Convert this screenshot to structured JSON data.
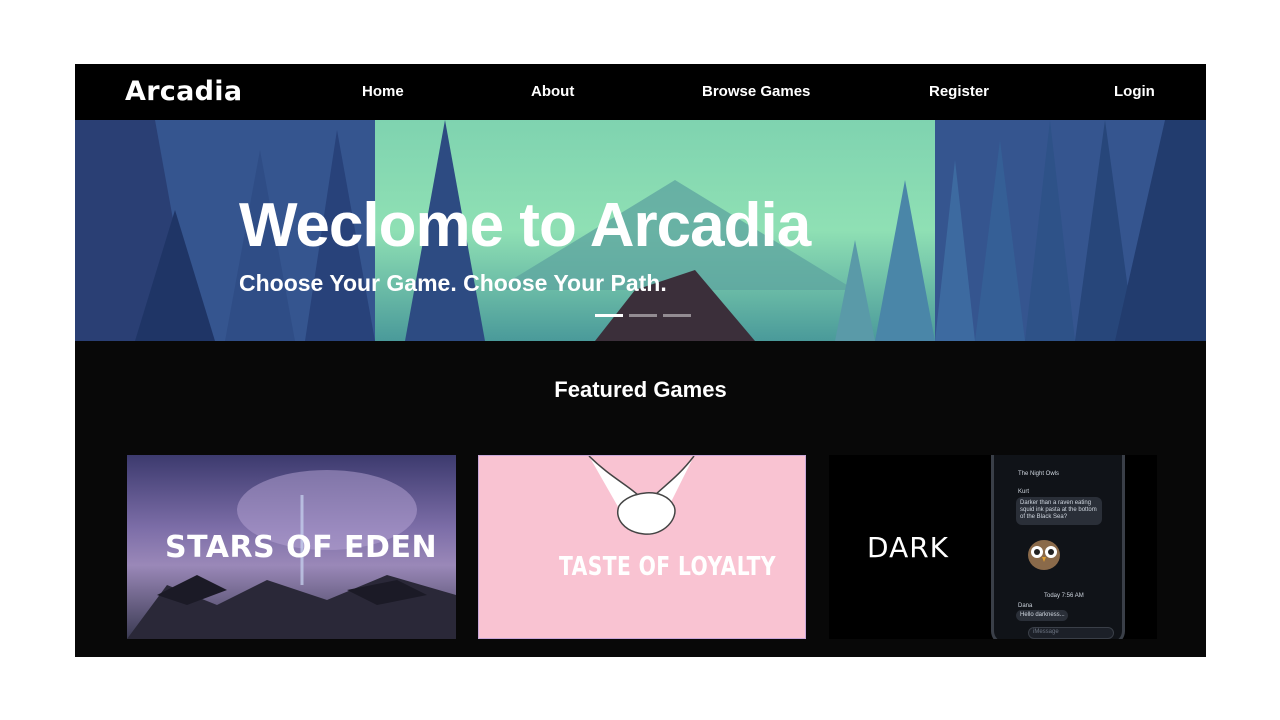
{
  "nav": {
    "brand": "Arcadia",
    "links": [
      "Home",
      "About",
      "Browse Games",
      "Register",
      "Login"
    ]
  },
  "hero": {
    "title": "Weclome to Arcadia",
    "subtitle": "Choose Your Game. Choose Your Path.",
    "slides": 3,
    "active_slide": 1
  },
  "featured": {
    "title": "Featured Games",
    "games": [
      {
        "title": "STARS OF EDEN"
      },
      {
        "title": "TASTE OF LOYALTY"
      },
      {
        "title": "DARK"
      }
    ]
  },
  "dark_preview": {
    "chat_name": "The Night Owls",
    "sender": "Kurt",
    "message": "Darker than a raven eating squid ink pasta at the bottom of the Black Sea?",
    "timestamp": "Today 7:56 AM",
    "reply_sender": "Dana",
    "reply": "Hello darkness...",
    "input_placeholder": "iMessage"
  },
  "colors": {
    "nav_bg": "#000000",
    "page_bg": "#080808",
    "card2_bg": "#f9c3d2"
  }
}
